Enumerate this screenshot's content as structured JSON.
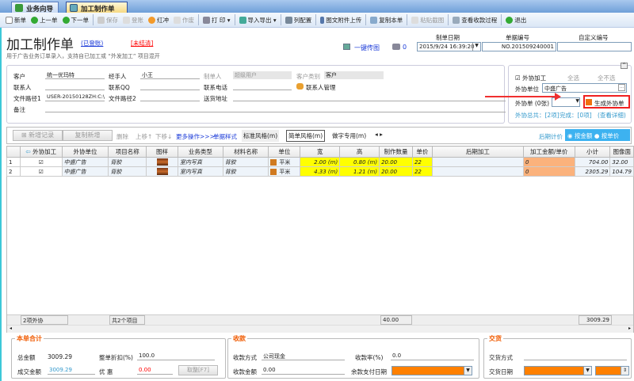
{
  "tabs": [
    {
      "label": "业务向导"
    },
    {
      "label": "加工制作单"
    }
  ],
  "toolbar": [
    "新单",
    "上一单",
    "下一单",
    "保存",
    "登账",
    "红冲",
    "作废",
    "打 印 ▾",
    "导入导出 ▾",
    "列配置",
    "图文附件上传",
    "复制本单",
    "粘贴截图",
    "查看收款过程",
    "退出"
  ],
  "header": {
    "title": "加工制作单",
    "status_posted": "(已登账)",
    "status_unsettled": "[未结清]",
    "subtitle": "用于广告业务订单录入，支持自已加工或 “外发加工” 项目混开",
    "upload_link": "一键传图",
    "print_count": "0",
    "date_label": "制单日期",
    "date_value": "2015/9/24 16:39:20",
    "number_label": "单据编号",
    "number_value": "NO.201509240001",
    "custom_label": "自定义编号",
    "custom_value": ""
  },
  "form": {
    "customer_label": "客户",
    "customer": "统一优玛特",
    "handler_label": "经手人",
    "handler": "小王",
    "maker_label": "制单人",
    "maker": "超级用户",
    "ctype_label": "客户类别",
    "ctype": "客户",
    "contact_label": "联系人",
    "contact": "",
    "qq_label": "联系QQ",
    "qq": "",
    "phone_label": "联系电话",
    "phone": "",
    "contact_mgr": "联系人管理",
    "path1_label": "文件路径1",
    "path1": "USER-20150128ZH:C:\\",
    "path2_label": "文件路径2",
    "path2": "",
    "addr_label": "送货地址",
    "addr": "",
    "note_label": "备注",
    "note": ""
  },
  "outsource": {
    "checkbox_label": "外协加工",
    "checked": true,
    "select_all": "全选",
    "deselect_all": "全不选",
    "unit_label": "外协单位",
    "unit": "中盛广告",
    "orders_label": "外协单 (0张)",
    "generate": "生成外协单",
    "total": "外协总共：[2项]",
    "done": "完成：[0项]",
    "detail": "(查看详细)"
  },
  "grid_toolbar": {
    "add": "新增记录",
    "copy": "复制新增",
    "delete": "删除",
    "up": "上移↑",
    "down": "下移↓",
    "more": "更多操作>>>",
    "style": "单据样式",
    "std": "标准风格(m)",
    "simple": "简单风格(m)",
    "word": "做字专用(m)",
    "pricing_label": "后期计价",
    "by_amount": "按金额",
    "by_unit": "按单价",
    "selected": "按金额"
  },
  "table": {
    "columns": [
      "",
      "外协加工",
      "外协单位",
      "项目名称",
      "图样",
      "业务类型",
      "材料名称",
      "单位",
      "宽",
      "高",
      "制作数量",
      "单价",
      "后期加工",
      "加工金额/单价",
      "小计",
      "图像面"
    ],
    "rows": [
      {
        "n": "1",
        "out": true,
        "unit": "中盛广告",
        "item": "背胶",
        "type": "室内写真",
        "mat": "背胶",
        "uom": "平米",
        "w": "2.00 (m)",
        "h": "0.80 (m)",
        "qty": "20.00",
        "price": "22",
        "post": "",
        "amt": "0",
        "sub": "704.00",
        "img": "32.00"
      },
      {
        "n": "2",
        "out": true,
        "unit": "中盛广告",
        "item": "背胶",
        "type": "室内写真",
        "mat": "背胶",
        "uom": "平米",
        "w": "4.33 (m)",
        "h": "1.21 (m)",
        "qty": "20.00",
        "price": "22",
        "post": "",
        "amt": "0",
        "sub": "2305.29",
        "img": "104.79"
      }
    ],
    "footer": {
      "out": "2项外协",
      "items": "共2个项目",
      "qty": "40.00",
      "sub": "3009.29"
    }
  },
  "totals": {
    "legend": "本单合计",
    "total_label": "总金额",
    "total": "3009.29",
    "discount_label": "整单折扣(%)",
    "discount": "100.0",
    "deal_label": "成交金额",
    "deal": "3009.29",
    "promo_label": "优 惠",
    "promo": "0.00",
    "round_btn": "取整[F7]"
  },
  "payment": {
    "legend": "收款",
    "method_label": "收款方式",
    "method": "公司现金",
    "rate_label": "收款率(%)",
    "rate": "0.0",
    "amount_label": "收款金额",
    "amount": "0.00",
    "due_label": "余款支付日期"
  },
  "delivery": {
    "legend": "交货",
    "method_label": "交货方式",
    "date_label": "交货日期"
  },
  "colors": {
    "accent": "#1a3ad8",
    "warn": "#f05a00",
    "highlight": "#ffff00",
    "orange": "#ff8000"
  }
}
